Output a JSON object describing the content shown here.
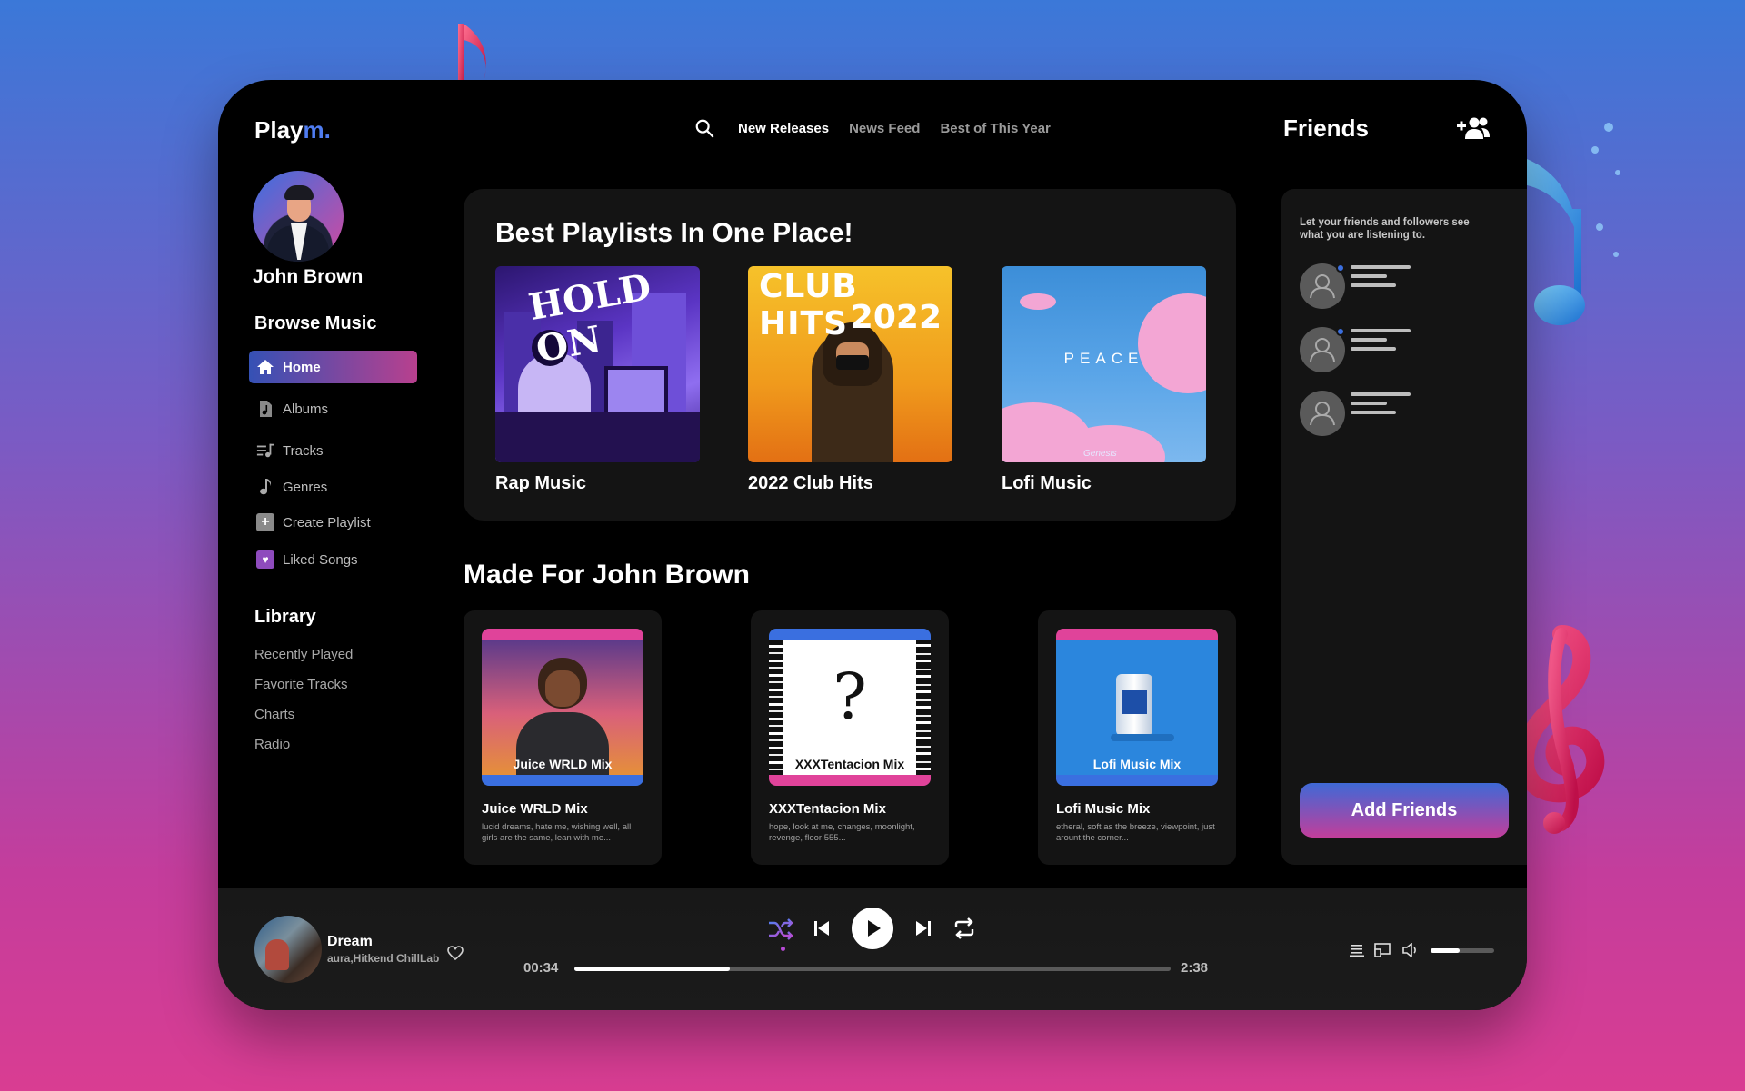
{
  "app": {
    "logo_main": "Play",
    "logo_accent": "m.",
    "accent_color": "#4f7cf0"
  },
  "topnav": {
    "items": [
      {
        "label": "New Releases",
        "active": true
      },
      {
        "label": "News Feed",
        "active": false
      },
      {
        "label": "Best of This Year",
        "active": false
      }
    ]
  },
  "profile": {
    "name": "John Brown"
  },
  "sidebar": {
    "browse_title": "Browse Music",
    "items": [
      {
        "label": "Home",
        "icon": "home-icon",
        "active": true
      },
      {
        "label": "Albums",
        "icon": "album-icon",
        "active": false
      },
      {
        "label": "Tracks",
        "icon": "tracks-icon",
        "active": false
      },
      {
        "label": "Genres",
        "icon": "music-note-icon",
        "active": false
      },
      {
        "label": "Create Playlist",
        "icon": "plus-icon",
        "active": false
      },
      {
        "label": "Liked Songs",
        "icon": "heart-icon",
        "active": false
      }
    ],
    "library_title": "Library",
    "library": [
      "Recently Played",
      "Favorite Tracks",
      "Charts",
      "Radio"
    ]
  },
  "best": {
    "title": "Best Playlists In One Place!",
    "playlists": [
      {
        "name": "Rap Music",
        "cover_text": "HOLD ON"
      },
      {
        "name": "2022 Club Hits",
        "cover_text_1": "CLUB HITS",
        "cover_text_2": "2022"
      },
      {
        "name": "Lofi Music",
        "cover_text": "PEACE",
        "cover_sig": "Genesis"
      }
    ]
  },
  "made_for": {
    "title": "Made For John Brown",
    "mixes": [
      {
        "name": "Juice WRLD Mix",
        "cover_label": "Juice WRLD Mix",
        "desc": "lucid dreams, hate me, wishing well, all girls are the same, lean with me...",
        "top_color": "#e0439a",
        "bottom_color": "#3a6fe0"
      },
      {
        "name": "XXXTentacion Mix",
        "cover_label": "XXXTentacion Mix",
        "desc": "hope, look at me, changes, moonlight, revenge, floor 555...",
        "top_color": "#3a6fe0",
        "bottom_color": "#e0439a"
      },
      {
        "name": "Lofi Music Mix",
        "cover_label": "Lofi Music Mix",
        "desc": "etheral, soft as the  breeze, viewpoint, just arount the corner...",
        "top_color": "#e0439a",
        "bottom_color": "#3a6fe0"
      }
    ]
  },
  "friends": {
    "title": "Friends",
    "hint": "Let your friends and followers see what you are listening to.",
    "count": 3,
    "add_label": "Add Friends"
  },
  "player": {
    "title": "Dream",
    "artist": "aura,Hitkend ChillLab",
    "current_time": "00:34",
    "total_time": "2:38",
    "progress": 0.26,
    "volume": 0.45
  }
}
